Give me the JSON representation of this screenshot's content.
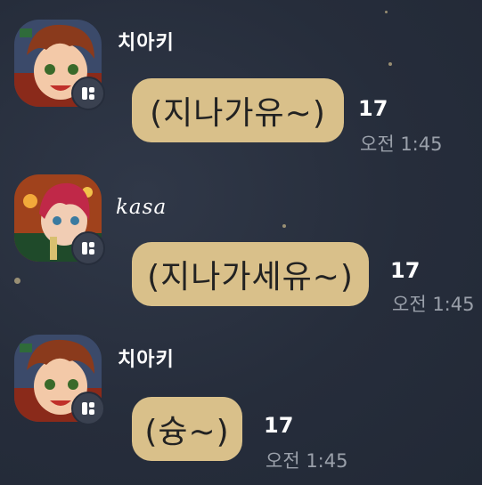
{
  "messages": [
    {
      "sender": "치아키",
      "text": "(지나가유~)",
      "read_count": "17",
      "time": "오전 1:45"
    },
    {
      "sender": "kasa",
      "text": "(지나가세유~)",
      "read_count": "17",
      "time": "오전 1:45"
    },
    {
      "sender": "치아키",
      "text": "(슝~)",
      "read_count": "17",
      "time": "오전 1:45"
    }
  ],
  "colors": {
    "background": "#262d3b",
    "bubble": "#d9c08a",
    "time": "#9aa0aa"
  }
}
